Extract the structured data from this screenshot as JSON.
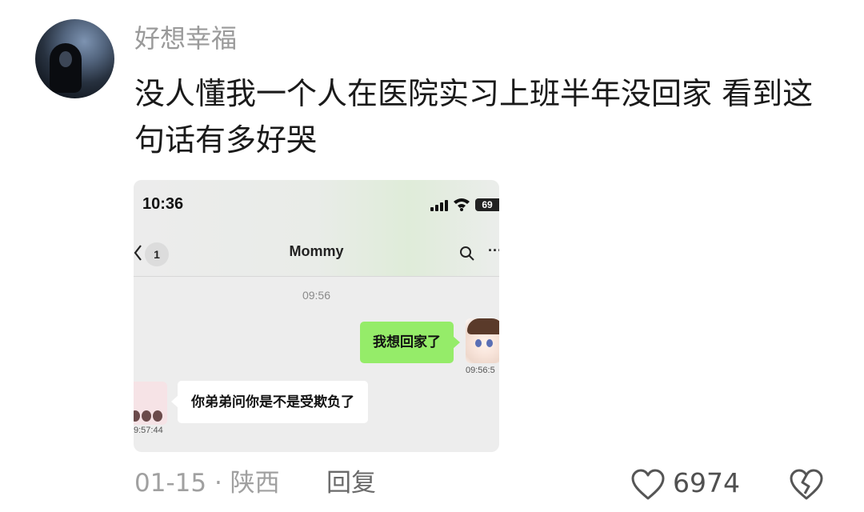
{
  "comment": {
    "username": "好想幸福",
    "text": "没人懂我一个人在医院实习上班半年没回家 看到这句话有多好哭",
    "date": "01-15",
    "separator": "·",
    "location": "陕西",
    "reply_label": "回复",
    "like_count": "6974"
  },
  "screenshot": {
    "status_time": "10:36",
    "battery": "69",
    "unread_count": "1",
    "chat_title": "Mommy",
    "center_timestamp": "09:56",
    "messages": [
      {
        "side": "right",
        "text": "我想回家了",
        "time": "09:56:5"
      },
      {
        "side": "left",
        "text": "你弟弟问你是不是受欺负了",
        "time": "9:57:44"
      }
    ],
    "colors": {
      "sent_bubble": "#95ec69",
      "received_bubble": "#ffffff"
    }
  },
  "icons": {
    "avatar": "user-avatar",
    "like": "heart-outline-icon",
    "dislike": "broken-heart-icon",
    "search": "search-icon",
    "more": "more-icon",
    "back": "back-chevron-icon"
  }
}
